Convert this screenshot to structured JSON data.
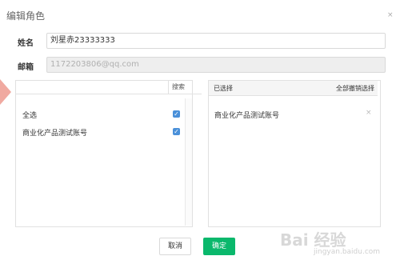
{
  "dialog": {
    "title": "编辑角色",
    "close_label": "×"
  },
  "form": {
    "name_label": "姓名",
    "name_value": "刘星赤23333333",
    "email_label": "邮箱",
    "email_value": "1172203806@qq.com"
  },
  "left_panel": {
    "search_placeholder": "",
    "search_button": "搜索",
    "items": [
      {
        "label": "全选",
        "checked": true
      },
      {
        "label": "商业化产品测试账号",
        "checked": true
      }
    ]
  },
  "right_panel": {
    "header_title": "已选择",
    "clear_all_label": "全部撤销选择",
    "selected": [
      {
        "label": "商业化产品测试账号",
        "remove_label": "×"
      }
    ]
  },
  "footer": {
    "cancel_label": "取消",
    "ok_label": "确定"
  },
  "colors": {
    "accent_green": "#0ab86c",
    "checkbox_blue": "#4a90d9",
    "arrow_pink": "#f0a9a0"
  },
  "watermark": {
    "text": "Bai 经验",
    "url": "jingyan.baidu.com"
  }
}
